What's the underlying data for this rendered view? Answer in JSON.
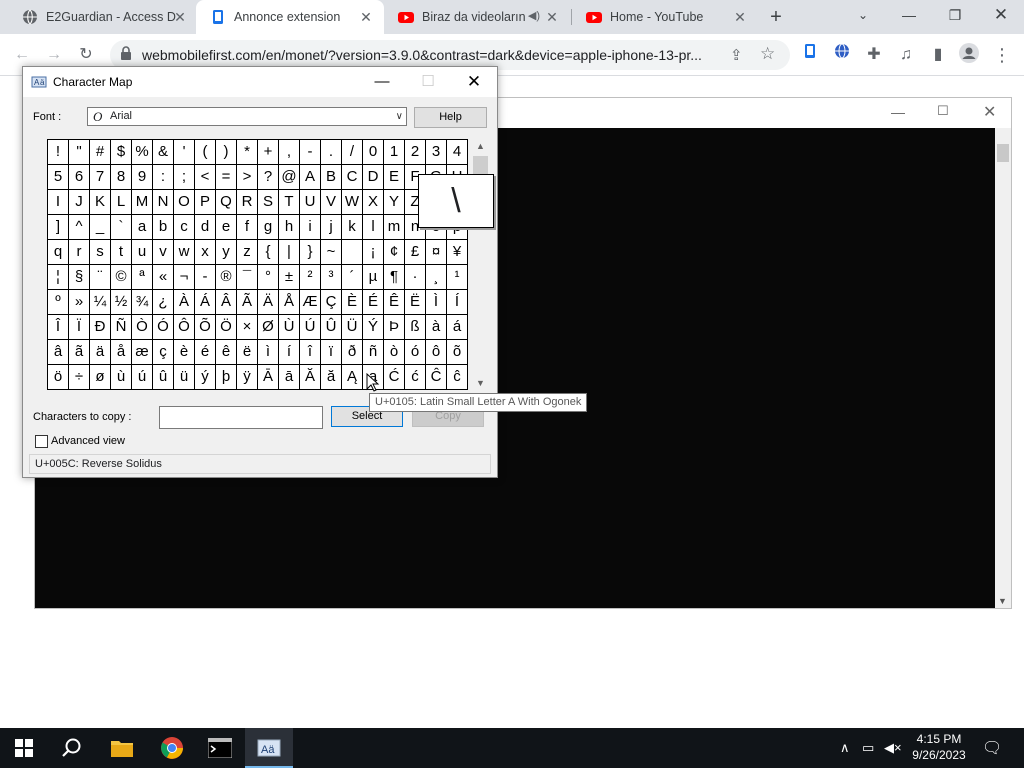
{
  "browser": {
    "tabs": [
      {
        "title": "E2Guardian - Access De",
        "icon": "shield-globe-icon",
        "active": false
      },
      {
        "title": "Annonce extension",
        "icon": "document-icon",
        "active": true
      },
      {
        "title": "Biraz da videoların",
        "icon": "youtube-icon",
        "active": false,
        "audio": true
      },
      {
        "title": "Home - YouTube",
        "icon": "youtube-icon",
        "active": false
      }
    ],
    "new_tab": "+",
    "url": "webmobilefirst.com/en/monet/?version=3.9.0&contrast=dark&device=apple-iphone-13-pr..."
  },
  "charmap": {
    "title": "Character Map",
    "font_label": "Font :",
    "font_value": "Arial",
    "help_label": "Help",
    "grid_rows": [
      [
        "!",
        "\"",
        "#",
        "$",
        "%",
        "&",
        "'",
        "(",
        ")",
        "*",
        "+",
        ",",
        "-",
        ".",
        "/",
        "0",
        "1",
        "2",
        "3",
        "4"
      ],
      [
        "5",
        "6",
        "7",
        "8",
        "9",
        ":",
        ";",
        "<",
        "=",
        ">",
        "?",
        "@",
        "A",
        "B",
        "C",
        "D",
        "E",
        "F",
        "G",
        "H"
      ],
      [
        "I",
        "J",
        "K",
        "L",
        "M",
        "N",
        "O",
        "P",
        "Q",
        "R",
        "S",
        "T",
        "U",
        "V",
        "W",
        "X",
        "Y",
        "Z",
        "[",
        "\\"
      ],
      [
        "]",
        "^",
        "_",
        "`",
        "a",
        "b",
        "c",
        "d",
        "e",
        "f",
        "g",
        "h",
        "i",
        "j",
        "k",
        "l",
        "m",
        "n",
        "o",
        "p"
      ],
      [
        "q",
        "r",
        "s",
        "t",
        "u",
        "v",
        "w",
        "x",
        "y",
        "z",
        "{",
        "|",
        "}",
        "~",
        " ",
        "¡",
        "¢",
        "£",
        "¤",
        "¥"
      ],
      [
        "¦",
        "§",
        "¨",
        "©",
        "ª",
        "«",
        "¬",
        "-",
        "®",
        "¯",
        "°",
        "±",
        "²",
        "³",
        "´",
        "µ",
        "¶",
        "·",
        "¸",
        "¹"
      ],
      [
        "º",
        "»",
        "¼",
        "½",
        "¾",
        "¿",
        "À",
        "Á",
        "Â",
        "Ã",
        "Ä",
        "Å",
        "Æ",
        "Ç",
        "È",
        "É",
        "Ê",
        "Ë",
        "Ì",
        "Í"
      ],
      [
        "Î",
        "Ï",
        "Ð",
        "Ñ",
        "Ò",
        "Ó",
        "Ô",
        "Õ",
        "Ö",
        "×",
        "Ø",
        "Ù",
        "Ú",
        "Û",
        "Ü",
        "Ý",
        "Þ",
        "ß",
        "à",
        "á"
      ],
      [
        "â",
        "ã",
        "ä",
        "å",
        "æ",
        "ç",
        "è",
        "é",
        "ê",
        "ë",
        "ì",
        "í",
        "î",
        "ï",
        "ð",
        "ñ",
        "ò",
        "ó",
        "ô",
        "õ"
      ],
      [
        "ö",
        "÷",
        "ø",
        "ù",
        "ú",
        "û",
        "ü",
        "ý",
        "þ",
        "ÿ",
        "Ā",
        "ā",
        "Ă",
        "ă",
        "Ą",
        "ą",
        "Ć",
        "ć",
        "Ĉ",
        "ĉ"
      ]
    ],
    "zoomed_char": "\\",
    "copy_label": "Characters to copy :",
    "copy_value": "",
    "select_label": "Select",
    "copy_button_label": "Copy",
    "advanced_label": "Advanced view",
    "status_text": "U+005C: Reverse Solidus",
    "tooltip": "U+0105: Latin Small Letter A With Ogonek"
  },
  "taskbar": {
    "time": "4:15 PM",
    "date": "9/26/2023"
  },
  "colors": {
    "tabstrip": "#dee1e6",
    "taskbar": "#101418",
    "accent": "#0078d7",
    "youtube": "#ff0000"
  }
}
